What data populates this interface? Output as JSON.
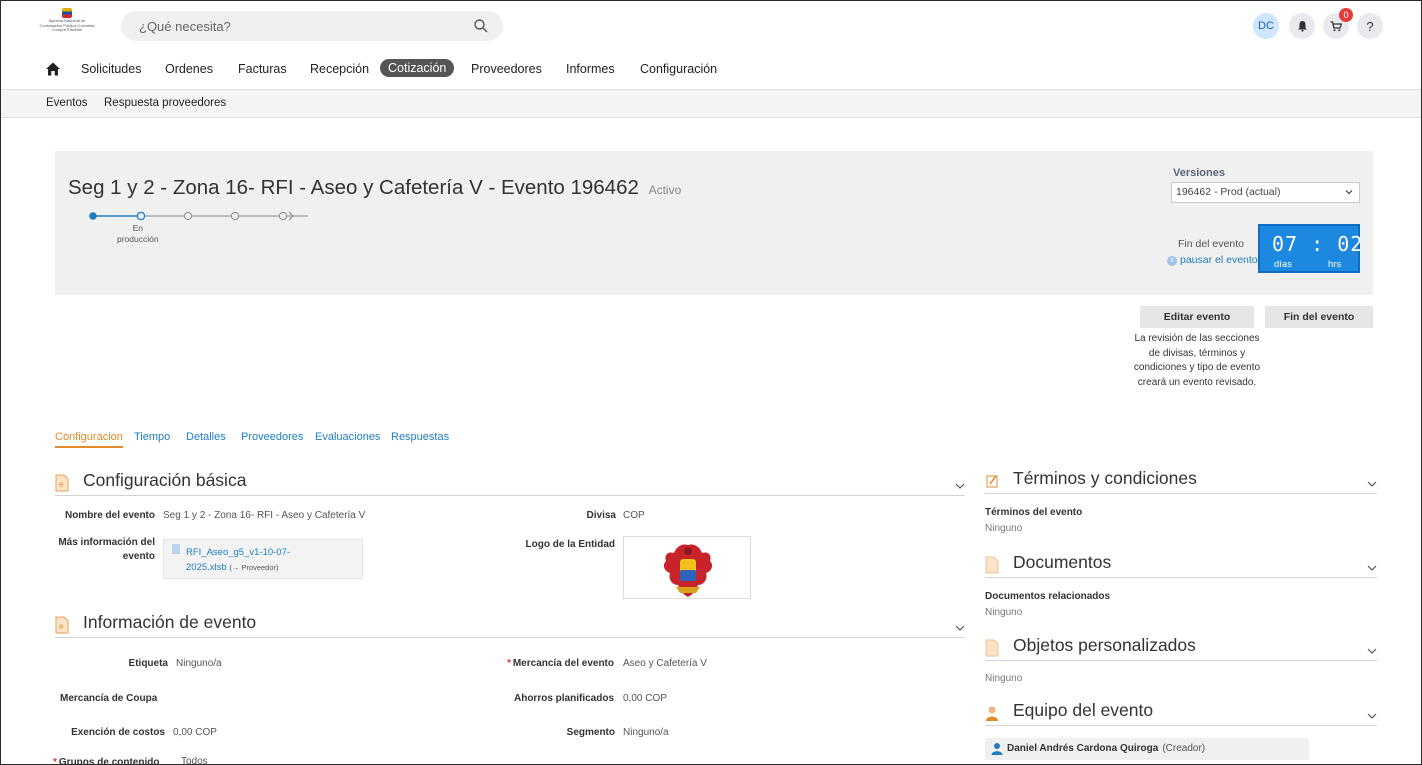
{
  "app": {
    "logo_text": "Agencia Nacional de Contratación Pública Colombia Compra Eficiente",
    "search_placeholder": "¿Qué necesita?",
    "user_initials": "DC",
    "cart_count": "0",
    "help_label": "?"
  },
  "nav": {
    "items": [
      "Solicitudes",
      "Ordenes",
      "Facturas",
      "Recepción",
      "Cotización",
      "Proveedores",
      "Informes",
      "Configuración"
    ],
    "active": "Cotización"
  },
  "subnav": {
    "items": [
      "Eventos",
      "Respuesta proveedores"
    ]
  },
  "event": {
    "title": "Seg 1 y 2 - Zona 16- RFI - Aseo y Cafetería V - Evento 196462",
    "status": "Activo",
    "stage_label_line1": "En",
    "stage_label_line2": "producción",
    "versions_label": "Versiones",
    "version_selected": "196462 - Prod (actual)",
    "fin_label": "Fin del evento",
    "pausar_label": "pausar el evento",
    "pausar_icon_text": "II",
    "timer": {
      "days": "07",
      "hours": "02",
      "separator": ":",
      "days_label": "días",
      "hours_label": "hrs"
    },
    "edit_button": "Editar evento",
    "fin_button": "Fin del evento",
    "edit_note": "La revisión de las secciones de divisas, términos y condiciones y tipo de evento creará un evento revisado."
  },
  "tabs": [
    "Configuracion",
    "Tiempo",
    "Detalles",
    "Proveedores",
    "Evaluaciones",
    "Respuestas"
  ],
  "config_basica": {
    "title": "Configuración básica",
    "nombre_label": "Nombre del evento",
    "nombre_value": "Seg 1 y 2 - Zona 16- RFI - Aseo y Cafetería V",
    "divisa_label": "Divisa",
    "divisa_value": "COP",
    "mas_info_label_1": "Más información del",
    "mas_info_label_2": "evento",
    "file_name_1": "RFI_Aseo_g5_v1-10-07-",
    "file_name_2": "2025.xlsb",
    "file_tail": "(→ Proveedor)",
    "logo_label": "Logo de la Entidad"
  },
  "info_evento": {
    "title": "Información de evento",
    "etiqueta_label": "Etiqueta",
    "etiqueta_value": "Ninguno/a",
    "mercancia_label": "Mercancía del evento",
    "mercancia_value": "Aseo y Cafetería V",
    "mercancia_coupa_label": "Mercancía de Coupa",
    "ahorros_label": "Ahorros planificados",
    "ahorros_value": "0,00 COP",
    "exencion_label": "Exención de costos",
    "exencion_value": "0,00 COP",
    "segmento_label": "Segmento",
    "segmento_value": "Ninguno/a",
    "grupos_label": "Grupos de contenido",
    "grupos_value": "Todos"
  },
  "right": {
    "terminos_title": "Términos y condiciones",
    "terminos_label": "Términos del evento",
    "terminos_value": "Ninguno",
    "documentos_title": "Documentos",
    "documentos_label": "Documentos relacionados",
    "documentos_value": "Ninguno",
    "objetos_title": "Objetos personalizados",
    "objetos_value": "Ninguno",
    "equipo_title": "Equipo del evento",
    "member_name": "Daniel Andrés Cardona Quiroga",
    "member_role": "(Creador)"
  },
  "colors": {
    "accent": "#1e7dc2",
    "active_tab": "#e38a2a",
    "timer": "#1d88e0",
    "badge": "#e63b3b"
  }
}
